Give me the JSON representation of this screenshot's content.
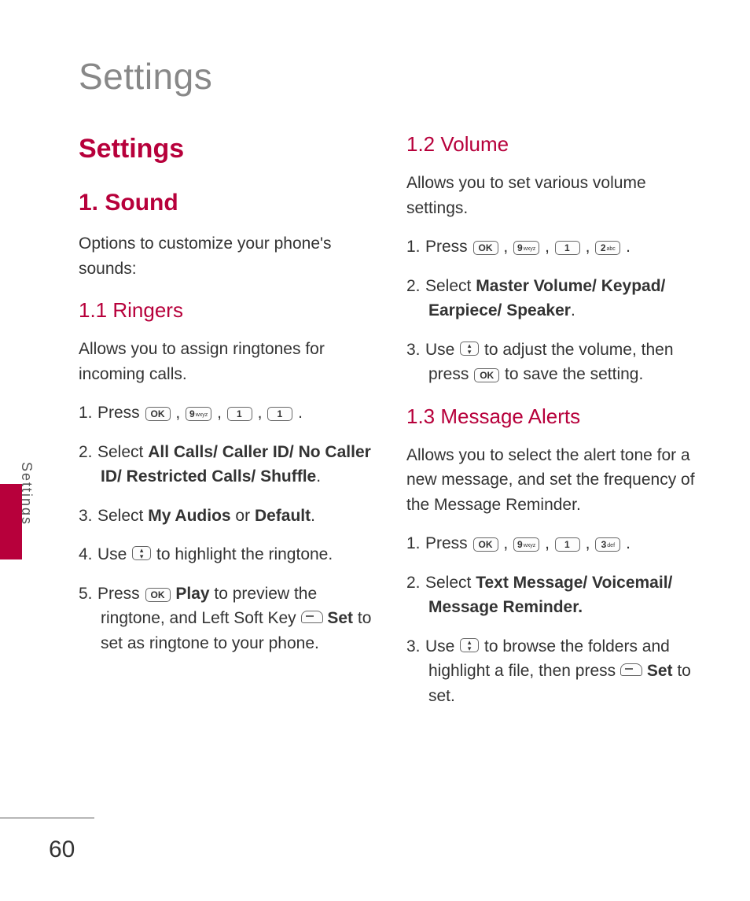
{
  "pageTitle": "Settings",
  "sideTab": "Settings",
  "pageNumber": "60",
  "keys": {
    "ok": "OK",
    "nine": {
      "big": "9",
      "small": "wxyz"
    },
    "one": {
      "big": "1",
      "small": ""
    },
    "two": {
      "big": "2",
      "small": "abc"
    },
    "three": {
      "big": "3",
      "small": "def"
    }
  },
  "left": {
    "settingsHeading": "Settings",
    "soundHeading": "1. Sound",
    "soundIntro": "Options to customize your phone's sounds:",
    "ringersHeading": "1.1 Ringers",
    "ringersIntro": "Allows you to assign ringtones for incoming calls.",
    "s1": {
      "n": "1.",
      "a": "Press "
    },
    "s2": {
      "n": "2.",
      "a": "Select ",
      "b": "All Calls/ Caller ID/ No Caller ID/ Restricted Calls/ Shuffle",
      "c": "."
    },
    "s3": {
      "n": "3.",
      "a": "Select ",
      "b": "My Audios",
      "c": " or ",
      "d": "Default",
      "e": "."
    },
    "s4": {
      "n": "4.",
      "a": "Use ",
      "b": " to highlight the ringtone."
    },
    "s5": {
      "n": "5.",
      "a": "Press ",
      "b": "Play",
      "c": " to preview the ringtone, and Left Soft Key ",
      "d": "Set",
      "e": " to set as ringtone to your phone."
    }
  },
  "right": {
    "volumeHeading": "1.2 Volume",
    "volumeIntro": "Allows you to set various volume settings.",
    "v1": {
      "n": "1.",
      "a": "Press "
    },
    "v2": {
      "n": "2.",
      "a": "Select ",
      "b": "Master Volume/ Keypad/ Earpiece/ Speaker",
      "c": "."
    },
    "v3": {
      "n": "3.",
      "a": "Use ",
      "b": " to adjust the volume, then press ",
      "c": " to save the setting."
    },
    "alertsHeading": "1.3 Message Alerts",
    "alertsIntro": "Allows you to select the alert tone for a new message, and set the frequency of the Message Reminder.",
    "m1": {
      "n": "1.",
      "a": "Press "
    },
    "m2": {
      "n": "2.",
      "a": "Select ",
      "b": "Text Message/ Voicemail/ Message Reminder."
    },
    "m3": {
      "n": "3.",
      "a": "Use ",
      "b": " to browse the folders and highlight a file, then press ",
      "c": "Set",
      "d": " to set."
    }
  }
}
